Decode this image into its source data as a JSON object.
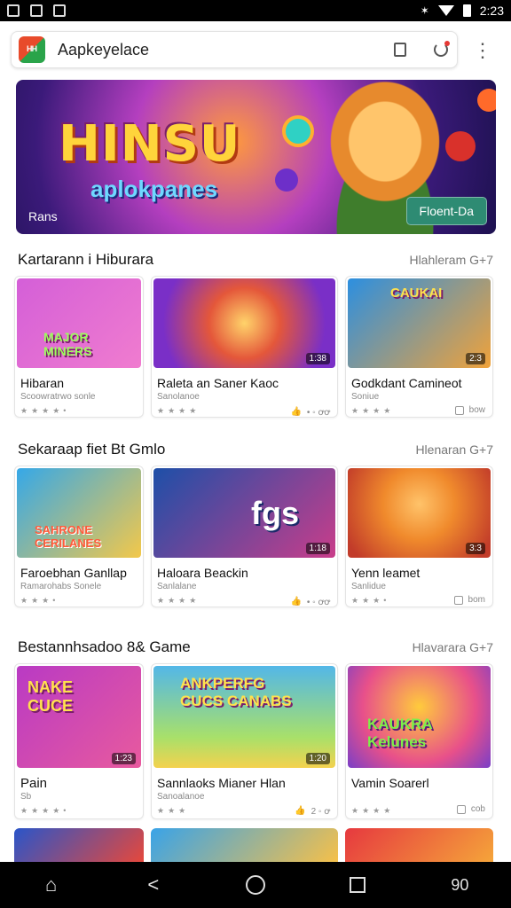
{
  "status_bar": {
    "time": "2:23"
  },
  "app_bar": {
    "logo_text": "ᴴᴴ",
    "title": "Aapkeyelace"
  },
  "hero": {
    "headline": "HINSU",
    "subline": "aplokpanes",
    "corner_label": "Rans",
    "button_label": "Floent-Da"
  },
  "sections": [
    {
      "title": "Kartarann i Hiburara",
      "more": "Hlahleram G+7",
      "cards": [
        {
          "title": "Hibaran",
          "subtitle": "Scoowratrwo sonle",
          "meta": "",
          "badge": "",
          "art": "MAJOR\nMINERS",
          "c1": "#d45fd8",
          "c2": "#f07ccf"
        },
        {
          "title": "Raleta an Saner Kaoc",
          "subtitle": "Sanolanoe",
          "meta": "• ◦ ꝍꝍ",
          "badge": "1:38",
          "art": "",
          "c1": "#e4573a",
          "c2": "#7a2fc7"
        },
        {
          "title": "Godkdant Camineot",
          "subtitle": "Soniue",
          "meta": "bow",
          "badge": "2:3",
          "art": "CAUKAI",
          "c1": "#2c8fe0",
          "c2": "#f0a23a"
        }
      ]
    },
    {
      "title": "Sekaraap fiet Bt Gmlo",
      "more": "Hlenaran G+7",
      "cards": [
        {
          "title": "Faroebhan Ganllap",
          "subtitle": "Ramarohabs Sonele",
          "meta": "",
          "badge": "",
          "art": "SAHRONE\nCERILANES",
          "c1": "#35a8e8",
          "c2": "#f3c84a"
        },
        {
          "title": "Haloara Beackin",
          "subtitle": "Sanlalane",
          "meta": "• ◦ ꝍꝍ",
          "badge": "1:18",
          "art": "fgs",
          "c1": "#1d4fa8",
          "c2": "#c93d8a"
        },
        {
          "title": "Yenn leamet",
          "subtitle": "Sanlidue",
          "meta": "bom",
          "badge": "3:3",
          "art": "",
          "c1": "#f08a2c",
          "c2": "#c23c2a"
        }
      ]
    },
    {
      "title": "Bestannhsadoo 8& Game",
      "more": "Hlavarara G+7",
      "cards": [
        {
          "title": "Pain",
          "subtitle": "Sb",
          "meta": "",
          "badge": "1:23",
          "art": "NAKE\nCUCE",
          "c1": "#b93ac4",
          "c2": "#e85a9e"
        },
        {
          "title": "Sannlaoks Mianer Hlan",
          "subtitle": "Sanoalanoe",
          "meta": "2 ◦ ꝍ",
          "badge": "1:20",
          "art": "ANKPERFG\nCUCS CANABS",
          "c1": "#53b7e8",
          "c2": "#f4d24e"
        },
        {
          "title": "Vamin Soarerl",
          "subtitle": "",
          "meta": "cob",
          "badge": "",
          "art": "KAUKRA\nKelunes",
          "c1": "#e8508a",
          "c2": "#ffcb3c"
        }
      ]
    }
  ],
  "bottom_cards": [
    {
      "c1": "#2a55c9",
      "c2": "#e5483c"
    },
    {
      "c1": "#39a3e8",
      "c2": "#f5c04a"
    },
    {
      "c1": "#e6393f",
      "c2": "#f5a43a"
    }
  ],
  "nav": {
    "right_label": "90"
  }
}
